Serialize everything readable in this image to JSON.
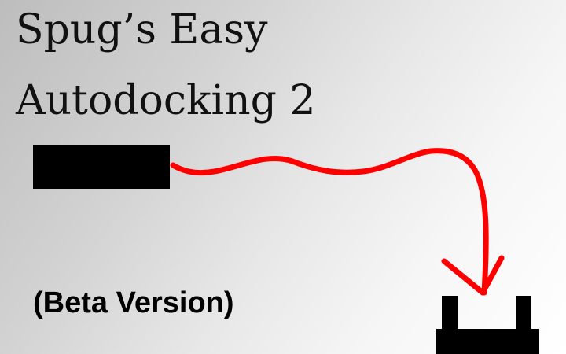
{
  "title": {
    "line1": "Spug’s Easy",
    "line2": "Autodocking 2"
  },
  "subtitle": "(Beta Version)",
  "colors": {
    "background_start": "#bdbdbd",
    "background_end": "#ffffff",
    "text": "#000000",
    "arrow": "#ff0000",
    "shapes": "#000000"
  },
  "icons": {
    "ship": "ship-block-icon",
    "path": "docking-path-arrow-icon",
    "dock": "docking-port-icon"
  }
}
